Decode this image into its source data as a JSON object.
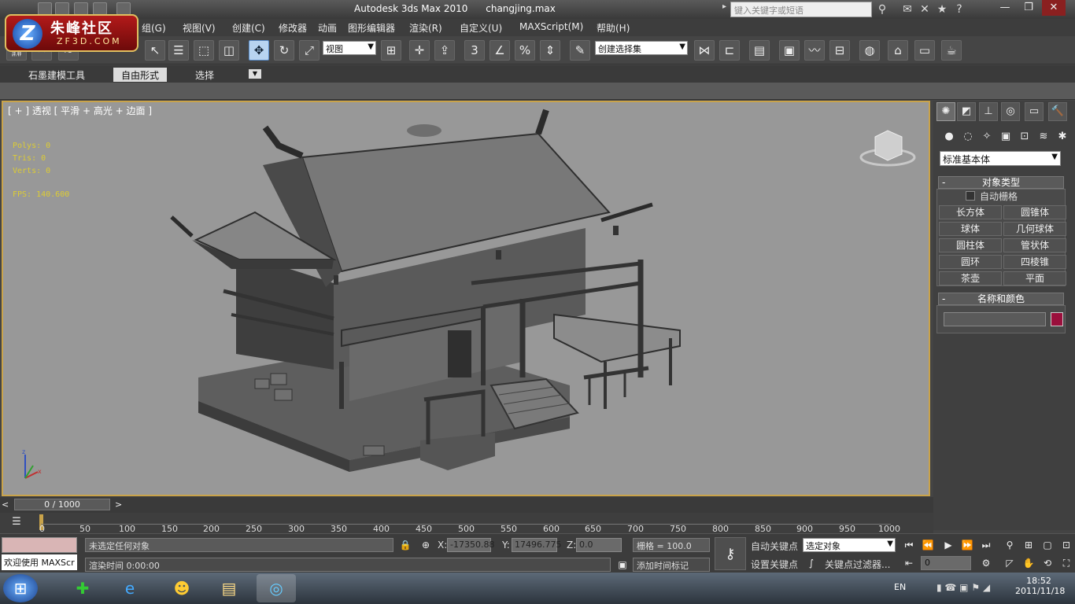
{
  "titlebar": {
    "app": "Autodesk 3ds Max  2010",
    "file": "changjing.max",
    "search_placeholder": "键入关键字或短语"
  },
  "logo": {
    "cn": "朱峰社区",
    "en": "ZF3D.COM",
    "mark": "Z"
  },
  "menus": [
    "组(G)",
    "视图(V)",
    "创建(C)",
    "修改器",
    "动画",
    "图形编辑器",
    "渲染(R)",
    "自定义(U)",
    "MAXScript(M)",
    "帮助(H)"
  ],
  "toolbar": {
    "view_dropdown": "视图",
    "selection_set": "创建选择集",
    "snap_label": "3"
  },
  "ribbon": {
    "tabs": [
      "石墨建模工具",
      "自由形式",
      "选择"
    ]
  },
  "viewport": {
    "label": "[ + ] 透视 [ 平滑 + 高光 + 边面 ]",
    "stats": [
      "Polys: 0",
      "Tris: 0",
      "Verts: 0"
    ],
    "fps": "FPS:  140.600"
  },
  "cmdpanel": {
    "category": "标准基本体",
    "object_type_title": "对象类型",
    "autogrid": "自动栅格",
    "objects": [
      "长方体",
      "圆锥体",
      "球体",
      "几何球体",
      "圆柱体",
      "管状体",
      "圆环",
      "四棱锥",
      "茶壶",
      "平面"
    ],
    "name_color_title": "名称和颜色",
    "object_color": "#9a0f3c"
  },
  "timeline": {
    "slider": "0 / 1000",
    "ticks": [
      "0",
      "50",
      "100",
      "150",
      "200",
      "250",
      "300",
      "350",
      "400",
      "450",
      "500",
      "550",
      "600",
      "650",
      "700",
      "750",
      "800",
      "850",
      "900",
      "950",
      "1000"
    ]
  },
  "status": {
    "maxscript": "欢迎使用 MAXScr",
    "prompt": "未选定任何对象",
    "render_time": "渲染时间  0:00:00",
    "x": "-17350.88",
    "y": "17496.775",
    "z": "0.0",
    "grid": "栅格 = 100.0",
    "add_tag": "添加时间标记",
    "autokey": "自动关键点",
    "setkey": "设置关键点",
    "selected": "选定对象",
    "key_filter": "关键点过滤器...",
    "frame": "0"
  },
  "taskbar": {
    "lang": "EN",
    "time": "18:52",
    "date": "2011/11/18"
  }
}
